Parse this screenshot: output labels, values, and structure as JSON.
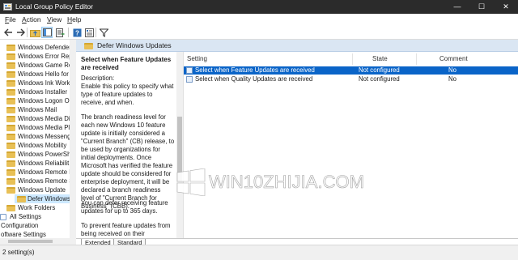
{
  "window": {
    "title": "Local Group Policy Editor",
    "minimize_glyph": "—",
    "maximize_glyph": "☐",
    "close_glyph": "✕"
  },
  "menu": {
    "items": [
      {
        "label": "File",
        "hotkey": "F",
        "rest": "ile"
      },
      {
        "label": "Action",
        "hotkey": "A",
        "rest": "ction"
      },
      {
        "label": "View",
        "hotkey": "V",
        "rest": "iew"
      },
      {
        "label": "Help",
        "hotkey": "H",
        "rest": "elp"
      }
    ]
  },
  "toolbar": {
    "icons": [
      "back-arrow-icon",
      "forward-arrow-icon",
      "folder-up-icon",
      "show-hide-tree-icon",
      "export-list-icon",
      "help-icon",
      "properties-icon",
      "filter-icon"
    ]
  },
  "tree": {
    "items": [
      {
        "label": "Windows Defender",
        "selected": false
      },
      {
        "label": "Windows Error Rep",
        "selected": false
      },
      {
        "label": "Windows Game Re",
        "selected": false
      },
      {
        "label": "Windows Hello for",
        "selected": false
      },
      {
        "label": "Windows Ink Work",
        "selected": false
      },
      {
        "label": "Windows Installer",
        "selected": false
      },
      {
        "label": "Windows Logon Op",
        "selected": false
      },
      {
        "label": "Windows Mail",
        "selected": false
      },
      {
        "label": "Windows Media Di",
        "selected": false
      },
      {
        "label": "Windows Media Pl",
        "selected": false
      },
      {
        "label": "Windows Messeng",
        "selected": false
      },
      {
        "label": "Windows Mobility",
        "selected": false
      },
      {
        "label": "Windows PowerSh",
        "selected": false
      },
      {
        "label": "Windows Reliabilit",
        "selected": false
      },
      {
        "label": "Windows Remote M",
        "selected": false
      },
      {
        "label": "Windows Remote S",
        "selected": false
      },
      {
        "label": "Windows Update",
        "selected": false
      },
      {
        "label": "Defer Windows",
        "selected": true
      },
      {
        "label": "Work Folders",
        "selected": false
      },
      {
        "label": "All Settings",
        "selected": false
      },
      {
        "label": "Configuration",
        "selected": false
      },
      {
        "label": "oftware Settings",
        "selected": false
      }
    ]
  },
  "pane": {
    "header_title": "Defer Windows Updates"
  },
  "description": {
    "title": "Select when Feature Updates are received",
    "label": "Description:",
    "paragraphs": [
      "Enable this policy to specify what type of feature updates to receive, and when.",
      "The branch readiness level for each new Windows 10 feature update is initially considered a \"Current Branch\" (CB) release, to be used by organizations for initial deployments. Once Microsoft has verified the feature update should be considered for enterprise deployment, it will be declared a branch readiness level of \"Current Branch for Business\" (CBB).",
      "You can defer receiving feature updates for up to 365 days.",
      "To prevent feature updates from being received on their scheduled"
    ]
  },
  "list": {
    "columns": {
      "setting": "Setting",
      "state": "State",
      "comment": "Comment"
    },
    "rows": [
      {
        "setting": "Select when Feature Updates are received",
        "state": "Not configured",
        "comment": "No",
        "selected": true
      },
      {
        "setting": "Select when Quality Updates are received",
        "state": "Not configured",
        "comment": "No",
        "selected": false
      }
    ]
  },
  "tabs": [
    {
      "label": "Extended",
      "active": true
    },
    {
      "label": "Standard",
      "active": false
    }
  ],
  "status": {
    "text": "2 setting(s)"
  },
  "watermark": {
    "brand": "WIN10ZHIJIA.COM"
  },
  "colors": {
    "titlebar": "#2b2b2b",
    "selection": "#0a64c8",
    "pane_header": "#dae6f3",
    "folder": "#e8c056"
  }
}
